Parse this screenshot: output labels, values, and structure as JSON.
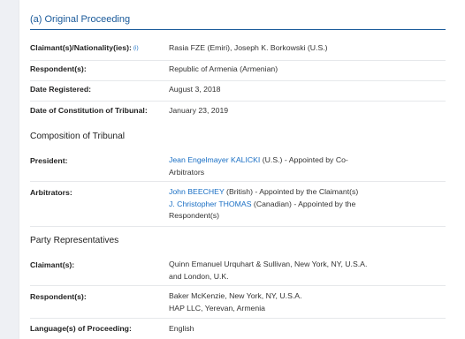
{
  "section": {
    "title": "(a) Original Proceeding"
  },
  "case": {
    "claimants_label": "Claimant(s)/Nationality(ies):",
    "claimants_info": "(i)",
    "claimants_value": "Rasia FZE (Emiri), Joseph K. Borkowski (U.S.)",
    "respondents_label": "Respondent(s):",
    "respondents_value": "Republic of Armenia (Armenian)",
    "date_registered_label": "Date Registered:",
    "date_registered_value": "August 3, 2018",
    "constitution_label": "Date of Constitution of Tribunal:",
    "constitution_value": "January 23, 2019"
  },
  "composition": {
    "heading": "Composition of Tribunal",
    "president_label": "President:",
    "president_name": "Jean Engelmayer KALICKI",
    "president_note": "(U.S.) - Appointed by Co-Arbitrators",
    "arbitrators_label": "Arbitrators:",
    "arbitrators": [
      {
        "name": "John BEECHEY",
        "note": "(British) - Appointed by the Claimant(s)"
      },
      {
        "name": "J. Christopher THOMAS",
        "note": "(Canadian) - Appointed by the Respondent(s)"
      }
    ]
  },
  "party_representatives": {
    "heading": "Party Representatives",
    "claimants_label": "Claimant(s):",
    "claimants_value": "Quinn Emanuel Urquhart & Sullivan, New York, NY, U.S.A. and London, U.K.",
    "respondents_label": "Respondent(s):",
    "respondents_lines": [
      "Baker McKenzie, New York, NY, U.S.A.",
      "HAP LLC, Yerevan, Armenia"
    ]
  },
  "language": {
    "label": "Language(s) of Proceeding:",
    "value": "English"
  },
  "colors": {
    "accent": "#1a5a9a",
    "link": "#1a6fc4",
    "divider": "#e6e8eb",
    "background": "#eef0f4"
  }
}
